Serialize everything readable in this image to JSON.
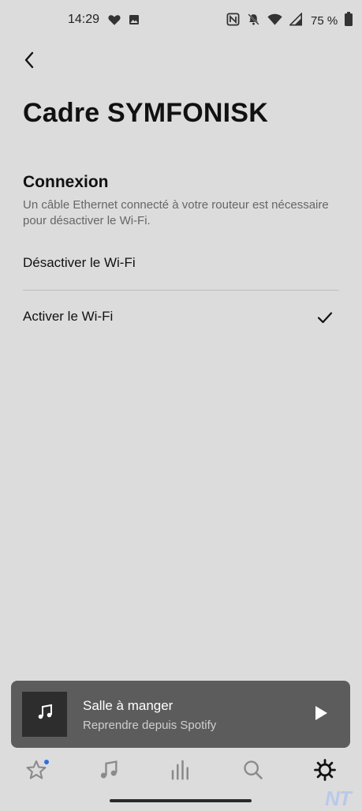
{
  "status_bar": {
    "time": "14:29",
    "battery": "75 %",
    "left_icons": [
      "heart-icon",
      "image-icon"
    ],
    "right_icons": [
      "nfc-icon",
      "bell-off-icon",
      "wifi-icon",
      "signal-icon",
      "battery-icon"
    ]
  },
  "header": {
    "back_icon": "chevron-left-icon",
    "title": "Cadre SYMFONISK"
  },
  "section": {
    "title": "Connexion",
    "description": "Un câble Ethernet connecté à votre routeur est nécessaire pour désactiver le Wi-Fi."
  },
  "options": [
    {
      "label": "Désactiver le Wi-Fi",
      "selected": false
    },
    {
      "label": "Activer le Wi-Fi",
      "selected": true
    }
  ],
  "mini_player": {
    "room": "Salle à manger",
    "source": "Reprendre depuis Spotify",
    "art_icon": "music-note-icon",
    "action_icon": "play-icon"
  },
  "bottom_nav": [
    {
      "name": "favorites",
      "icon": "star-icon",
      "active": false,
      "badge": true
    },
    {
      "name": "music",
      "icon": "music-note-icon",
      "active": false,
      "badge": false
    },
    {
      "name": "rooms",
      "icon": "bars-icon",
      "active": false,
      "badge": false
    },
    {
      "name": "search",
      "icon": "search-icon",
      "active": false,
      "badge": false
    },
    {
      "name": "settings",
      "icon": "gear-icon",
      "active": true,
      "badge": false
    }
  ],
  "watermark": "NT",
  "colors": {
    "background": "#dcdcdc",
    "player_background": "#5c5c5c",
    "inactive_icon": "#8a8a8a",
    "active_icon": "#111111",
    "badge": "#2f6fe0"
  }
}
